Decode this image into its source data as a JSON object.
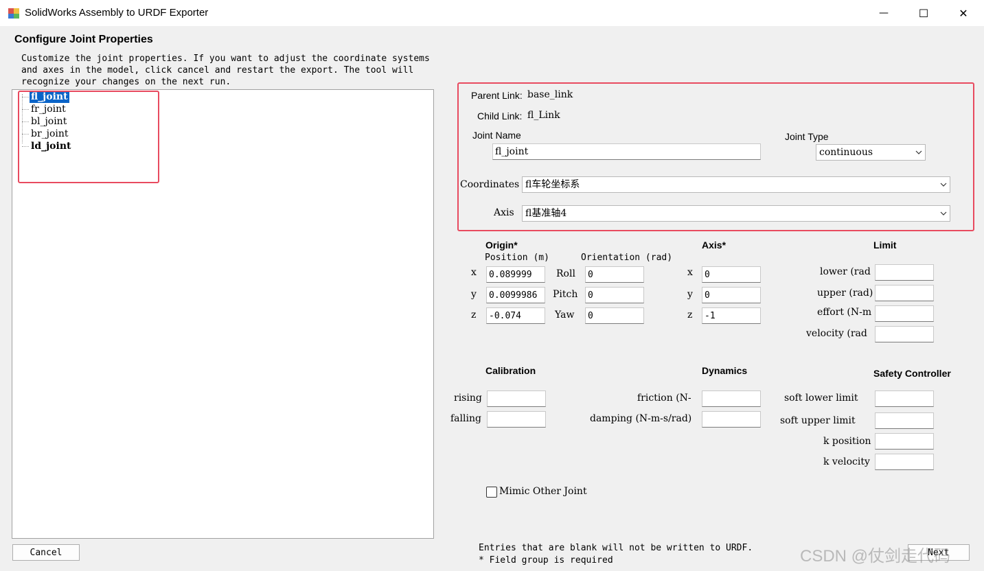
{
  "window": {
    "title": "SolidWorks Assembly to URDF Exporter",
    "minimize_glyph": "—",
    "maximize_glyph": "☐",
    "close_glyph": "✕"
  },
  "heading": "Configure Joint Properties",
  "instructions": "Customize the joint properties. If you want to adjust the coordinate systems\nand axes in the model, click cancel and restart the export. The tool will\nrecognize your changes on the next run.",
  "tree": {
    "items": [
      {
        "label": "fl_joint",
        "selected": true
      },
      {
        "label": "fr_joint"
      },
      {
        "label": "bl_joint"
      },
      {
        "label": "br_joint"
      },
      {
        "label": "ld_joint",
        "bold": true
      }
    ]
  },
  "properties": {
    "parent_link_label": "Parent Link:",
    "parent_link_value": "base_link",
    "child_link_label": "Child Link:",
    "child_link_value": "fl_Link",
    "joint_name_label": "Joint Name",
    "joint_name_value": "fl_joint",
    "joint_type_label": "Joint Type",
    "joint_type_value": "continuous",
    "coordinates_label": "Coordinates",
    "coordinates_value": "fl车轮坐标系",
    "axis_label": "Axis",
    "axis_value": "fl基准轴4"
  },
  "origin": {
    "title": "Origin*",
    "position_label": "Position (m)",
    "orientation_label": "Orientation (rad)",
    "x_label": "x",
    "y_label": "y",
    "z_label": "z",
    "x": "0.089999",
    "y": "0.0099986",
    "z": "-0.074",
    "roll_label": "Roll",
    "pitch_label": "Pitch",
    "yaw_label": "Yaw",
    "roll": "0",
    "pitch": "0",
    "yaw": "0"
  },
  "axis": {
    "title": "Axis*",
    "x_label": "x",
    "y_label": "y",
    "z_label": "z",
    "x": "0",
    "y": "0",
    "z": "-1"
  },
  "limit": {
    "title": "Limit",
    "lower_label": "lower (rad",
    "upper_label": "upper (rad)",
    "effort_label": "effort (N-m",
    "velocity_label": "velocity (rad"
  },
  "calibration": {
    "title": "Calibration",
    "rising_label": "rising",
    "falling_label": "falling"
  },
  "dynamics": {
    "title": "Dynamics",
    "friction_label": "friction (N-",
    "damping_label": "damping (N-m-s/rad)"
  },
  "safety": {
    "title": "Safety Controller",
    "soft_lower_label": "soft lower limit",
    "soft_upper_label": "soft upper limit",
    "k_position_label": "k position",
    "k_velocity_label": "k velocity"
  },
  "mimic_label": "Mimic Other Joint",
  "footer": {
    "note1": "Entries that are blank will not be written to URDF.",
    "note2": "* Field group is required",
    "cancel_label": "Cancel",
    "next_label": "Next"
  },
  "watermark": "CSDN @仗剑走代码",
  "colors": {
    "selection": "#0a64c8",
    "highlight_box": "#e84a5f"
  }
}
